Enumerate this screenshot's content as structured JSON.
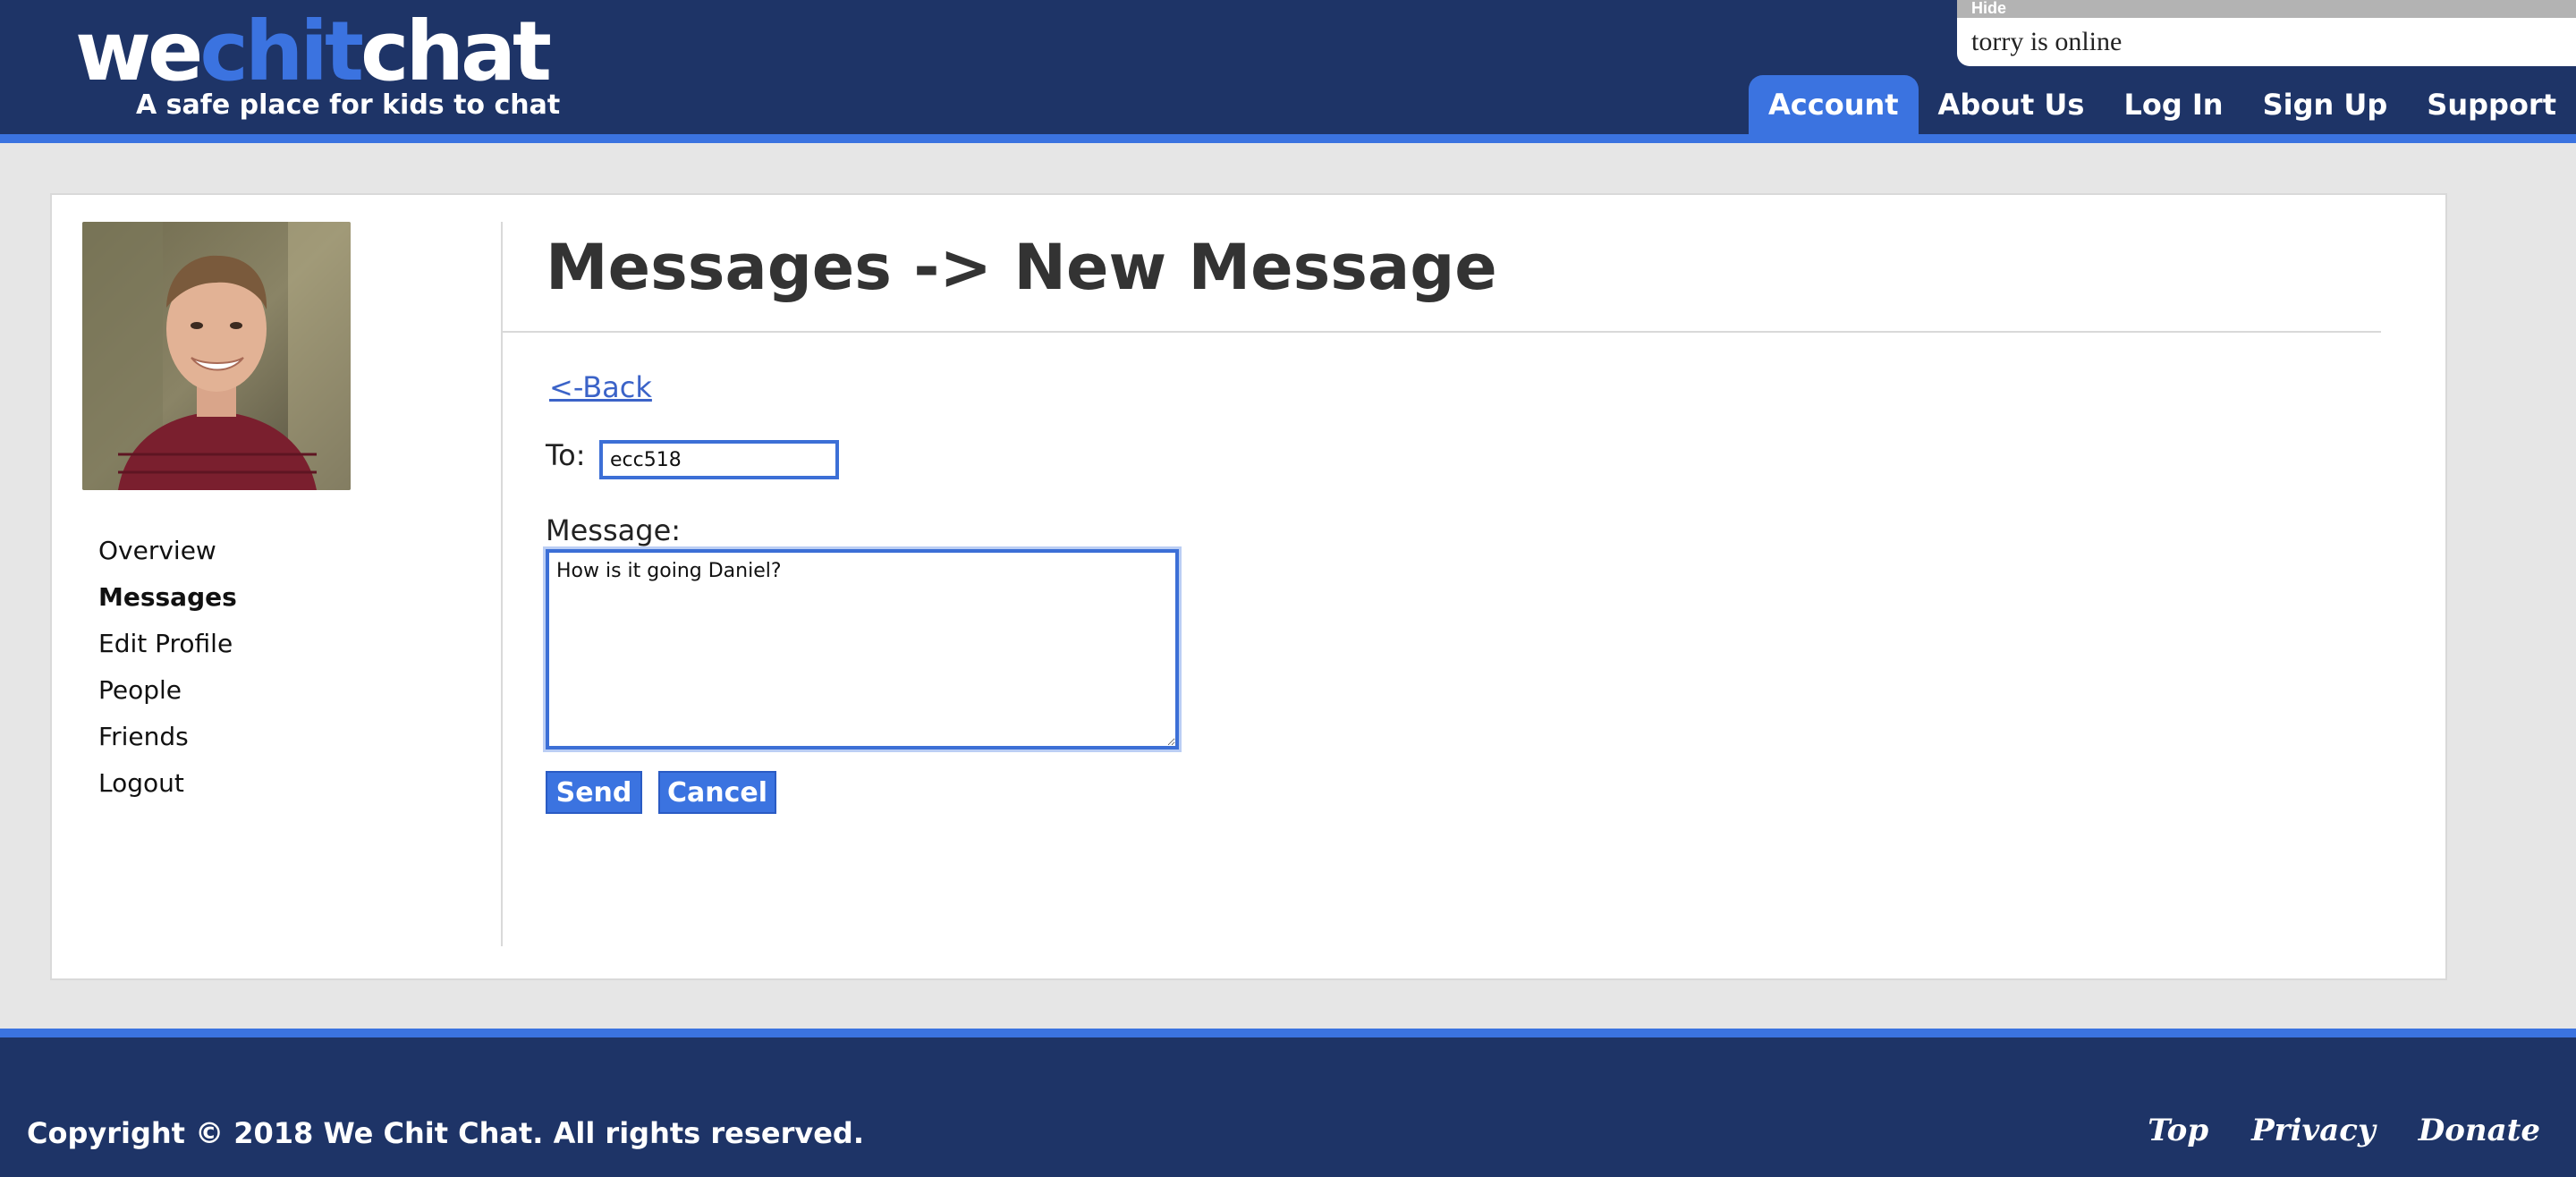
{
  "header": {
    "logo": {
      "part1": "we",
      "part2": "chit",
      "part3": "chat"
    },
    "tagline": "A safe place for kids to chat",
    "nav": [
      {
        "label": "Account",
        "active": true
      },
      {
        "label": "About Us",
        "active": false
      },
      {
        "label": "Log In",
        "active": false
      },
      {
        "label": "Sign Up",
        "active": false
      },
      {
        "label": "Support",
        "active": false
      }
    ]
  },
  "presence": {
    "hide_label": "Hide",
    "status_text": "torry is online"
  },
  "sidebar": {
    "items": [
      {
        "label": "Overview",
        "active": false
      },
      {
        "label": "Messages",
        "active": true
      },
      {
        "label": "Edit Profile",
        "active": false
      },
      {
        "label": "People",
        "active": false
      },
      {
        "label": "Friends",
        "active": false
      },
      {
        "label": "Logout",
        "active": false
      }
    ]
  },
  "main": {
    "title": "Messages -> New Message",
    "back_link": "<-Back",
    "to_label": "To:",
    "to_value": "ecc518",
    "message_label": "Message:",
    "message_value": "How is it going Daniel?",
    "send_label": "Send",
    "cancel_label": "Cancel"
  },
  "footer": {
    "copyright": "Copyright © 2018 We Chit Chat. All rights reserved.",
    "links": [
      "Top",
      "Privacy",
      "Donate"
    ]
  },
  "colors": {
    "navy": "#1e3467",
    "accent": "#3b73e0"
  }
}
